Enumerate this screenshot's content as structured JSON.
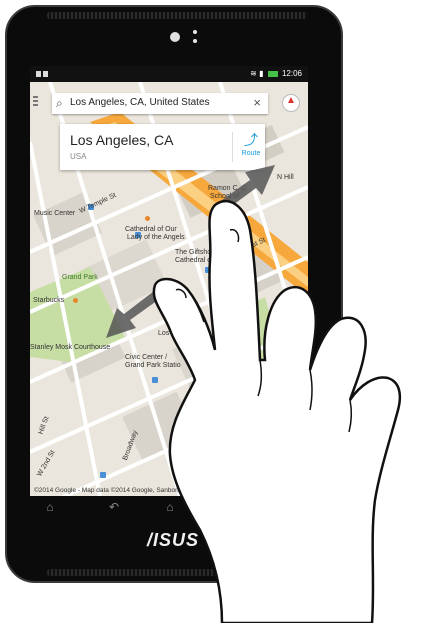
{
  "status": {
    "time": "12:06"
  },
  "search": {
    "query": "Los Angeles, CA, United States"
  },
  "card": {
    "place": "Los Angeles, CA",
    "country": "USA",
    "route_label": "Route"
  },
  "map_labels": {
    "ramon": "Ramon C. C",
    "school": "School of",
    "music_center": "Music Center",
    "cathedral1": "Cathedral of Our",
    "cathedral2": "Lady of the Angels",
    "giftshop": "The Giftsho",
    "cathedral3": "Cathedral of Ou",
    "grand_park": "Grand Park",
    "starbucks": "Starbucks",
    "courthouse": "Stanley Mosk Courthouse",
    "civic1": "Civic Center /",
    "civic2": "Grand Park Statio",
    "los": "Los",
    "temple": "W Temple St",
    "first": "W 1st St",
    "hill": "Hill St",
    "broadway": "Broadway",
    "second": "W 2nd St",
    "n_hill": "N Hill",
    "attribution": "©2014 Google - Map data ©2014 Google, Sanborn"
  },
  "device": {
    "logo": "/ISUS"
  },
  "colors": {
    "route_blue": "#1a9bd7",
    "highway": "#f6a83c",
    "park_green": "#c6dea3",
    "battery": "#45c245"
  }
}
